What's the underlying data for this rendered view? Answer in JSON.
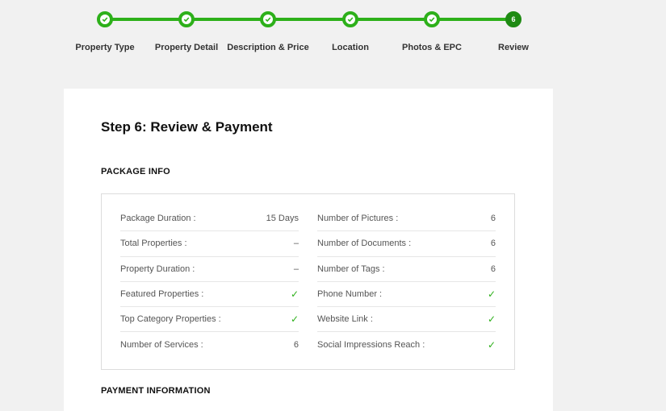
{
  "stepper": {
    "steps": [
      {
        "label": "Property Type",
        "status": "done"
      },
      {
        "label": "Property Detail",
        "status": "done"
      },
      {
        "label": "Description & Price",
        "status": "done"
      },
      {
        "label": "Location",
        "status": "done"
      },
      {
        "label": "Photos & EPC",
        "status": "done"
      },
      {
        "label": "Review",
        "status": "current",
        "number": "6"
      }
    ],
    "accent_color": "#2db01a"
  },
  "card": {
    "title": "Step 6: Review & Payment",
    "package_title": "PACKAGE INFO",
    "payment_title": "PAYMENT INFORMATION",
    "left_rows": [
      {
        "label": "Package Duration :",
        "value": "15 Days"
      },
      {
        "label": "Total Properties :",
        "value": "–"
      },
      {
        "label": "Property Duration :",
        "value": "–"
      },
      {
        "label": "Featured Properties :",
        "value": "✓"
      },
      {
        "label": "Top Category Properties :",
        "value": "✓"
      },
      {
        "label": "Number of Services :",
        "value": "6"
      }
    ],
    "right_rows": [
      {
        "label": "Number of Pictures :",
        "value": "6"
      },
      {
        "label": "Number of Documents :",
        "value": "6"
      },
      {
        "label": "Number of Tags :",
        "value": "6"
      },
      {
        "label": "Phone Number :",
        "value": "✓"
      },
      {
        "label": "Website Link :",
        "value": "✓"
      },
      {
        "label": "Social Impressions Reach :",
        "value": "✓"
      }
    ]
  }
}
